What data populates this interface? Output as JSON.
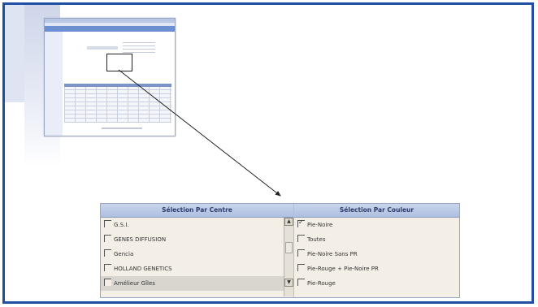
{
  "left_panel": {
    "header": "Sélection Par Centre",
    "items": [
      {
        "label": "G.S.I.",
        "checked": false
      },
      {
        "label": "GENES DIFFUSION",
        "checked": false
      },
      {
        "label": "Gencia",
        "checked": false
      },
      {
        "label": "HOLLAND GENETICS",
        "checked": false
      },
      {
        "label": "Amélieur Gîles",
        "checked": false
      }
    ]
  },
  "right_panel": {
    "header": "Sélection Par Couleur",
    "items": [
      {
        "label": "Pie-Noire",
        "checked": true
      },
      {
        "label": "Toutes",
        "checked": false
      },
      {
        "label": "Pie-Noire Sans PR",
        "checked": false
      },
      {
        "label": "Pie-Rouge + Pie-Noire PR",
        "checked": false
      },
      {
        "label": "Pie-Rouge",
        "checked": false
      }
    ]
  },
  "icons": {
    "scroll_up": "arrow-up-icon",
    "scroll_down": "arrow-down-icon"
  },
  "colors": {
    "frame_border": "#1f4ea3",
    "header_text": "#2b3d6b",
    "panel_bg": "#f4efe6"
  }
}
